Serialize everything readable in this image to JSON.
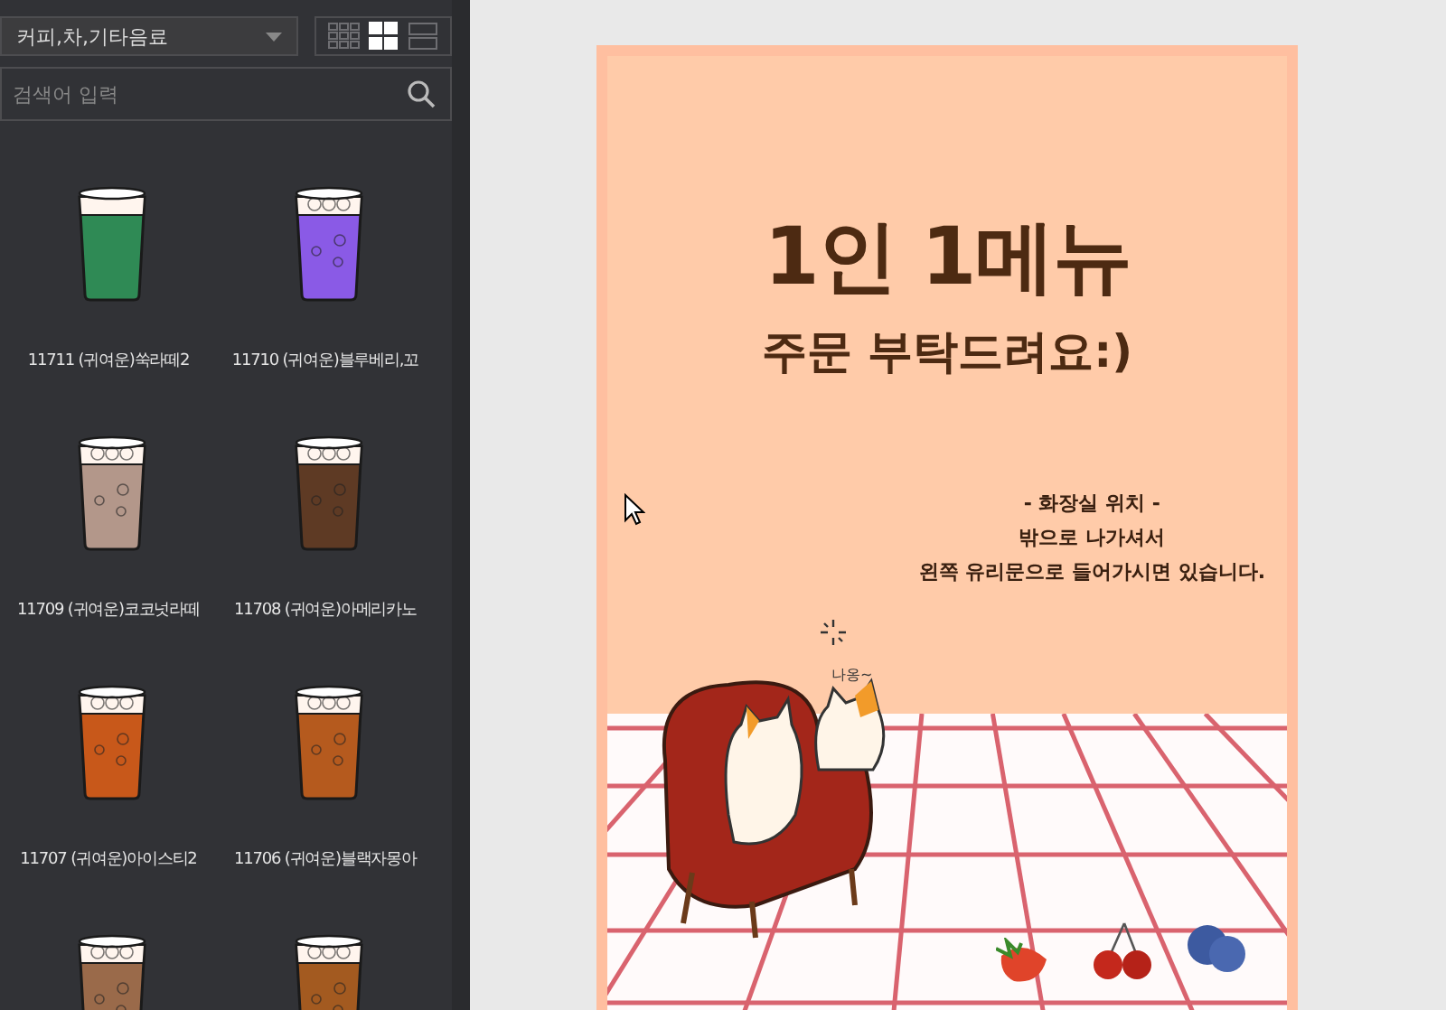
{
  "sidebar": {
    "category_dropdown": {
      "value": "커피,차,기타음료"
    },
    "view_modes": [
      {
        "kind": "small-grid",
        "selected": false
      },
      {
        "kind": "large-grid",
        "selected": true
      },
      {
        "kind": "list",
        "selected": false
      }
    ],
    "search": {
      "placeholder": "검색어 입력"
    },
    "items": [
      {
        "label": "11711 (귀여운)쑥라떼2",
        "color": "#2f8a55",
        "ice": false
      },
      {
        "label": "11710 (귀여운)블루베리,꼬",
        "color": "#8a5ae6",
        "ice": true
      },
      {
        "label": "11709 (귀여운)코코넛라떼",
        "color": "#b3978a",
        "ice": true
      },
      {
        "label": "11708 (귀여운)아메리카노",
        "color": "#5e3a24",
        "ice": true
      },
      {
        "label": "11707 (귀여운)아이스티2",
        "color": "#c8581a",
        "ice": true
      },
      {
        "label": "11706 (귀여운)블랙자몽아",
        "color": "#b55a1e",
        "ice": true
      },
      {
        "color": "#9a6a4a",
        "ice": true
      },
      {
        "color": "#a35a20",
        "ice": true
      }
    ]
  },
  "poster": {
    "title": "1인 1메뉴",
    "subtitle": "주문 부탁드려요:)",
    "notice": [
      "- 화장실 위치 -",
      "밖으로 나가셔서",
      "왼쪽 유리문으로 들어가시면 있습니다."
    ],
    "cat_sound": "나옹~"
  }
}
